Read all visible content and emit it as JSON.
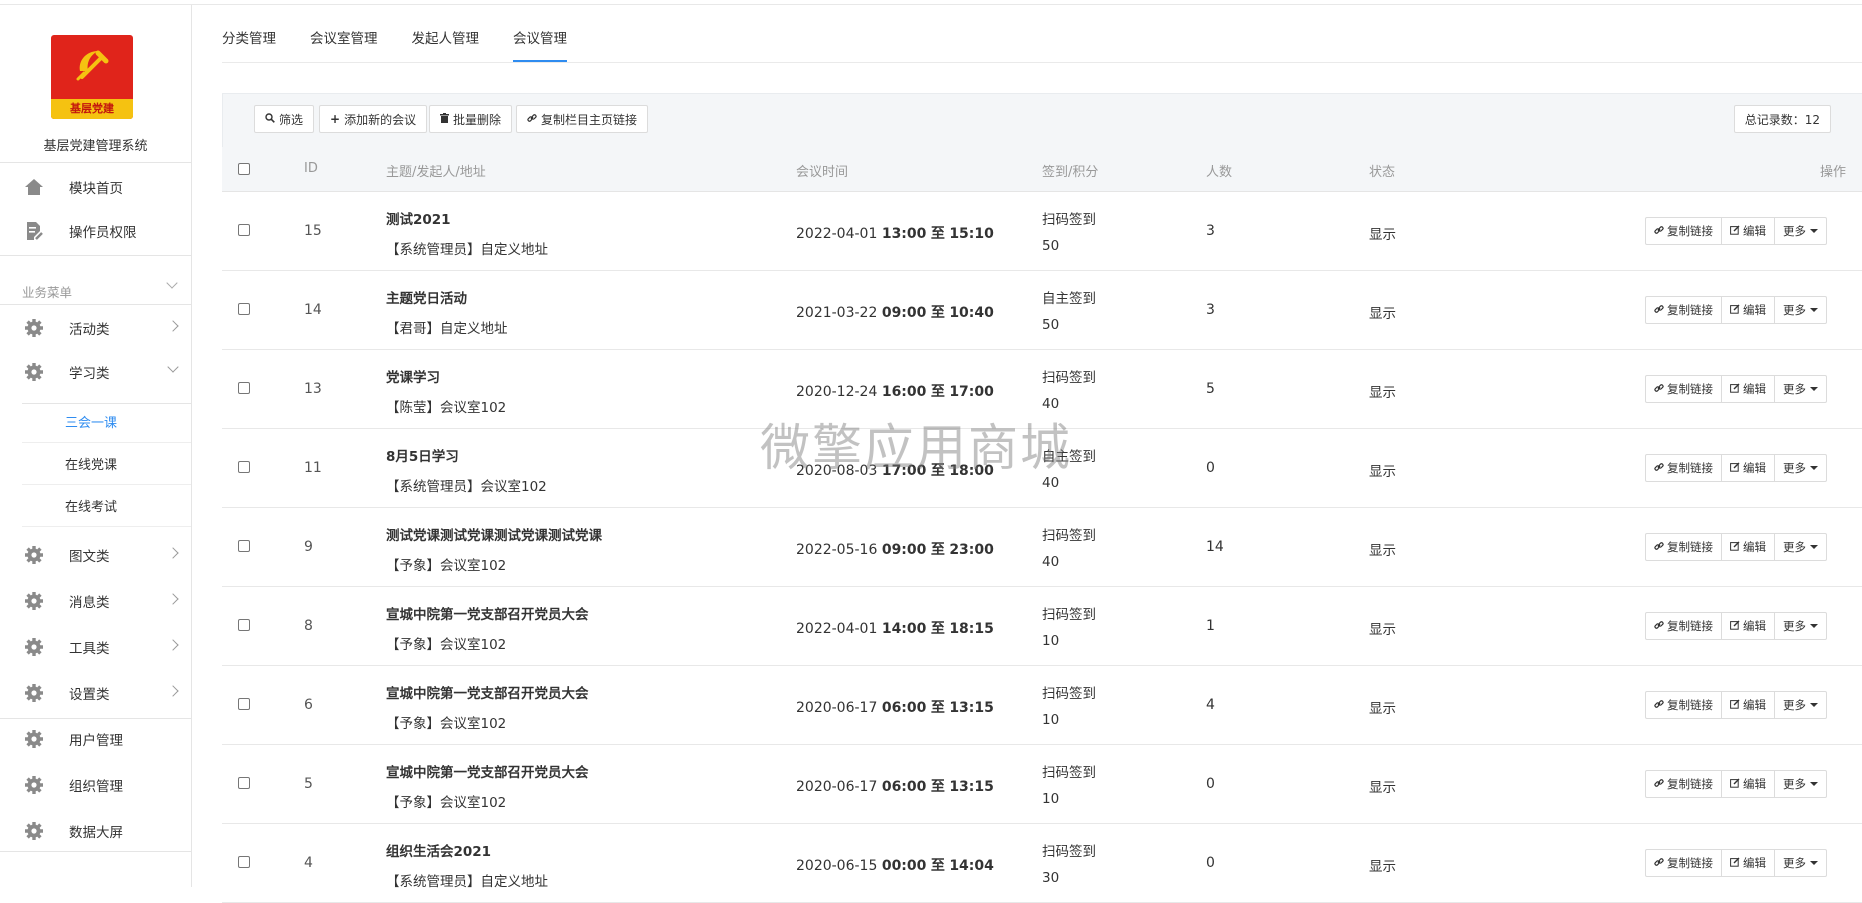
{
  "sidebar": {
    "logo_text": "基层党建",
    "system_name": "基层党建管理系统",
    "top_items": [
      {
        "label": "模块首页",
        "icon": "home-icon"
      },
      {
        "label": "操作员权限",
        "icon": "edit-doc-icon"
      }
    ],
    "group_title": "业务菜单",
    "items": [
      {
        "label": "活动类",
        "icon": "gear-icon"
      },
      {
        "label": "学习类",
        "icon": "gear-icon"
      },
      {
        "label": "图文类",
        "icon": "gear-icon"
      },
      {
        "label": "消息类",
        "icon": "gear-icon"
      },
      {
        "label": "工具类",
        "icon": "gear-icon"
      },
      {
        "label": "设置类",
        "icon": "gear-icon"
      },
      {
        "label": "用户管理",
        "icon": "gear-icon"
      },
      {
        "label": "组织管理",
        "icon": "gear-icon"
      },
      {
        "label": "数据大屏",
        "icon": "gear-icon"
      }
    ],
    "sub_items": [
      {
        "label": "三会一课",
        "active": true
      },
      {
        "label": "在线党课",
        "active": false
      },
      {
        "label": "在线考试",
        "active": false
      }
    ]
  },
  "tabs": [
    {
      "label": "分类管理",
      "active": false
    },
    {
      "label": "会议室管理",
      "active": false
    },
    {
      "label": "发起人管理",
      "active": false
    },
    {
      "label": "会议管理",
      "active": true
    }
  ],
  "toolbar": {
    "filter_label": "筛选",
    "add_label": "添加新的会议",
    "batch_delete_label": "批量删除",
    "copy_link_label": "复制栏目主页链接",
    "total_label": "总记录数：12"
  },
  "table": {
    "headers": {
      "id": "ID",
      "title": "主题/发起人/地址",
      "time": "会议时间",
      "sign": "签到/积分",
      "count": "人数",
      "status": "状态",
      "ops": "操作"
    },
    "op_labels": {
      "copy": "复制链接",
      "edit": "编辑",
      "more": "更多"
    },
    "rows": [
      {
        "id": "15",
        "title": "测试2021",
        "sub": "【系统管理员】自定义地址",
        "date": "2022-04-01",
        "start": "13:00",
        "sep": "至",
        "end": "15:10",
        "sign": "扫码签到",
        "points": "50",
        "count": "3",
        "status": "显示"
      },
      {
        "id": "14",
        "title": "主题党日活动",
        "sub": "【君哥】自定义地址",
        "date": "2021-03-22",
        "start": "09:00",
        "sep": "至",
        "end": "10:40",
        "sign": "自主签到",
        "points": "50",
        "count": "3",
        "status": "显示"
      },
      {
        "id": "13",
        "title": "党课学习",
        "sub": "【陈莹】会议室102",
        "date": "2020-12-24",
        "start": "16:00",
        "sep": "至",
        "end": "17:00",
        "sign": "扫码签到",
        "points": "40",
        "count": "5",
        "status": "显示"
      },
      {
        "id": "11",
        "title": "8月5日学习",
        "sub": "【系统管理员】会议室102",
        "date": "2020-08-03",
        "start": "17:00",
        "sep": "至",
        "end": "18:00",
        "sign": "自主签到",
        "points": "40",
        "count": "0",
        "status": "显示"
      },
      {
        "id": "9",
        "title": "测试党课测试党课测试党课测试党课",
        "sub": "【予象】会议室102",
        "date": "2022-05-16",
        "start": "09:00",
        "sep": "至",
        "end": "23:00",
        "sign": "扫码签到",
        "points": "40",
        "count": "14",
        "status": "显示"
      },
      {
        "id": "8",
        "title": "宣城中院第一党支部召开党员大会",
        "sub": "【予象】会议室102",
        "date": "2022-04-01",
        "start": "14:00",
        "sep": "至",
        "end": "18:15",
        "sign": "扫码签到",
        "points": "10",
        "count": "1",
        "status": "显示"
      },
      {
        "id": "6",
        "title": "宣城中院第一党支部召开党员大会",
        "sub": "【予象】会议室102",
        "date": "2020-06-17",
        "start": "06:00",
        "sep": "至",
        "end": "13:15",
        "sign": "扫码签到",
        "points": "10",
        "count": "4",
        "status": "显示"
      },
      {
        "id": "5",
        "title": "宣城中院第一党支部召开党员大会",
        "sub": "【予象】会议室102",
        "date": "2020-06-17",
        "start": "06:00",
        "sep": "至",
        "end": "13:15",
        "sign": "扫码签到",
        "points": "10",
        "count": "0",
        "status": "显示"
      },
      {
        "id": "4",
        "title": "组织生活会2021",
        "sub": "【系统管理员】自定义地址",
        "date": "2020-06-15",
        "start": "00:00",
        "sep": "至",
        "end": "14:04",
        "sign": "扫码签到",
        "points": "30",
        "count": "0",
        "status": "显示"
      }
    ]
  },
  "watermark": "微擎应用商城",
  "colors": {
    "accent": "#2f8cf0",
    "logo_red": "#e0241b",
    "logo_yellow": "#f5c211"
  }
}
